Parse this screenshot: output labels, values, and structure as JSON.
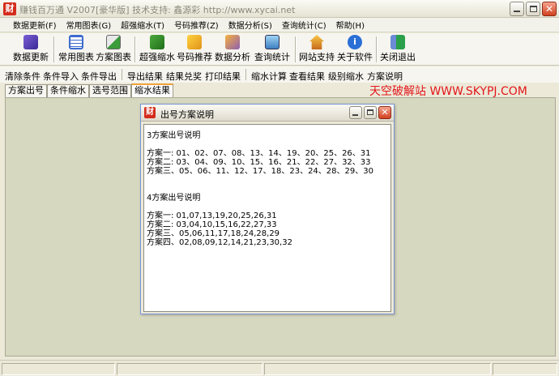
{
  "window": {
    "title": "赚钱百万通  V2007[豪华版]  技术支持: 鑫源彩 http://www.xycai.net"
  },
  "menu": [
    "数据更新(F)",
    "常用图表(G)",
    "超强缩水(T)",
    "号码推荐(Z)",
    "数据分析(S)",
    "查询统计(C)",
    "帮助(H)"
  ],
  "toolbar": {
    "data_update": "数据更新",
    "common_chart": "常用图表",
    "scheme_chart": "方案图表",
    "super_shrink": "超强缩水",
    "number_recommend": "号码推荐",
    "data_analysis": "数据分析",
    "query_stats": "查询统计",
    "web_support": "网站支持",
    "about": "关于软件",
    "exit": "关闭退出"
  },
  "toolbar2": {
    "clear_conditions": "清除条件",
    "import_conditions": "条件导入",
    "export_conditions": "条件导出",
    "export_results": "导出结果",
    "redeem_results": "结果兑奖",
    "print_results": "打印结果",
    "shrink_calc": "缩水计算",
    "view_results": "查看结果",
    "level_shrink": "级别缩水",
    "scheme_notes": "方案说明"
  },
  "tabs": [
    "方案出号",
    "条件缩水",
    "选号范围",
    "缩水结果"
  ],
  "active_tab": 3,
  "watermark": "天空破解站 WWW.SKYPJ.COM",
  "dialog": {
    "title": "出号方案说明",
    "lines": [
      "3方案出号说明",
      "",
      "方案一: 01、02、07、08、13、14、19、20、25、26、31",
      "方案二: 03、04、09、10、15、16、21、22、27、32、33",
      "方案三、05、06、11、12、17、18、23、24、28、29、30",
      "",
      "4方案出号说明",
      "",
      "方案一: 01,07,13,19,20,25,26,31",
      "方案二: 03,04,10,15,16,22,27,33",
      "方案三、05,06,11,17,18,24,28,29",
      "方案四、02,08,09,12,14,21,23,30,32"
    ]
  },
  "colors": {
    "watermark": "#e3161b",
    "workspace": "#d6d8c0",
    "app_icon": "#d42c1c"
  }
}
